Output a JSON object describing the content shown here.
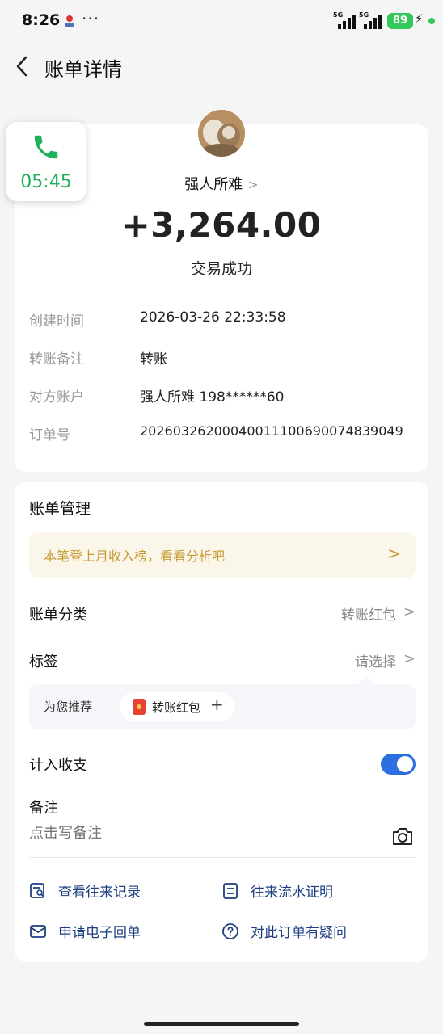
{
  "status_bar": {
    "time": "8:26",
    "more": "···",
    "signal_1": "5G",
    "signal_2": "5G",
    "battery": "89"
  },
  "nav": {
    "title": "账单详情"
  },
  "call_float": {
    "timer": "05:45"
  },
  "summary": {
    "payee": "强人所难",
    "payee_chevron": ">",
    "amount": "+3,264.00",
    "status": "交易成功",
    "details": [
      {
        "label": "创建时间",
        "value": "2026-03-26 22:33:58"
      },
      {
        "label": "转账备注",
        "value": "转账"
      },
      {
        "label": "对方账户",
        "value": "强人所难 198******60"
      },
      {
        "label": "订单号",
        "value": "20260326200040011100690074839049"
      }
    ]
  },
  "management": {
    "title": "账单管理",
    "banner_text": "本笔登上月收入榜，看看分析吧",
    "banner_chevron": ">",
    "category_label": "账单分类",
    "category_value": "转账红包",
    "tag_label": "标签",
    "tag_value": "请选择",
    "chevron": ">",
    "recommend_label": "为您推荐",
    "recommend_chip": "转账红包",
    "recommend_plus": "+",
    "count_label": "计入收支",
    "count_enabled": true,
    "note_label": "备注",
    "note_placeholder": "点击写备注"
  },
  "actions": [
    {
      "label": "查看往来记录"
    },
    {
      "label": "往来流水证明"
    },
    {
      "label": "申请电子回单"
    },
    {
      "label": "对此订单有疑问"
    }
  ],
  "colors": {
    "accent_blue": "#2b6fe3",
    "action_text": "#1d3f80",
    "banner_text": "#c79a33",
    "call_green": "#1db15c",
    "battery_green": "#34c759"
  }
}
